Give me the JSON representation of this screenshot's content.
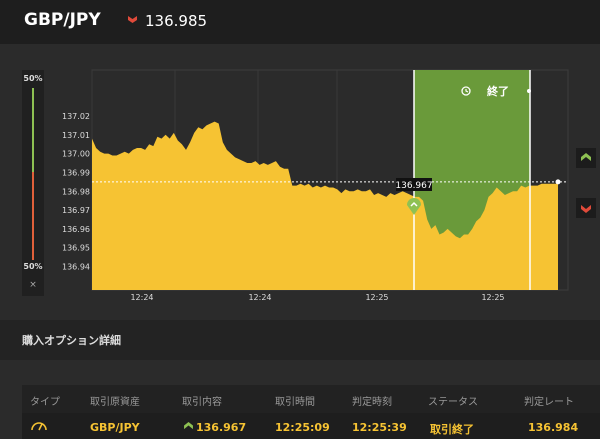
{
  "header": {
    "pair": "GBP/JPY",
    "direction_icon": "chevron-down-icon",
    "price": "136.985"
  },
  "gauge": {
    "top_percent": "50%",
    "bottom_percent": "50%",
    "close_label": "×"
  },
  "chart_data": {
    "type": "area",
    "title": "",
    "ylim": [
      136.93,
      137.03
    ],
    "y_ticks": [
      "137.02",
      "137.01",
      "137.00",
      "136.99",
      "136.98",
      "136.97",
      "136.96",
      "136.95",
      "136.94"
    ],
    "x_ticks": [
      "12:24",
      "12:24",
      "12:25",
      "12:25"
    ],
    "series": [
      {
        "values": [
          137.008,
          137.003,
          137.001,
          137.0,
          137.0,
          136.999,
          136.999,
          137.0,
          137.001,
          137.0,
          137.002,
          137.003,
          137.003,
          137.002,
          137.005,
          137.004,
          137.009,
          137.008,
          137.01,
          137.008,
          137.011,
          137.007,
          137.005,
          137.002,
          137.006,
          137.011,
          137.014,
          137.013,
          137.015,
          137.016,
          137.017,
          137.016,
          137.006,
          137.002,
          137.0,
          136.998,
          136.997,
          136.996,
          136.995,
          136.995,
          136.996,
          136.994,
          136.995,
          136.994,
          136.995,
          136.996,
          136.993,
          136.992,
          136.992,
          136.983,
          136.983,
          136.984,
          136.983,
          136.984,
          136.982,
          136.983,
          136.982,
          136.983,
          136.982,
          136.982,
          136.981,
          136.979,
          136.981,
          136.98,
          136.98,
          136.981,
          136.98,
          136.98,
          136.981,
          136.978,
          136.979,
          136.978,
          136.977,
          136.979,
          136.978,
          136.979,
          136.98,
          136.979,
          136.978,
          136.977,
          136.977,
          136.975,
          136.965,
          136.96,
          136.962,
          136.957,
          136.958,
          136.96,
          136.958,
          136.956,
          136.955,
          136.957,
          136.957,
          136.96,
          136.964,
          136.966,
          136.97,
          136.977,
          136.979,
          136.982,
          136.98,
          136.978,
          136.979,
          136.98,
          136.98,
          136.983,
          136.982,
          136.983,
          136.983,
          136.983,
          136.984,
          136.984,
          136.984,
          136.984,
          136.984
        ]
      }
    ],
    "reference_line": 136.985,
    "entry_marker": {
      "label": "136.967",
      "icon": "chevron-up-icon"
    },
    "expiry_zone": {
      "label": "終了",
      "icon": "clock-icon",
      "color": "#6a9a3a"
    },
    "colors": {
      "fill": "#f6c333",
      "background": "#2b2b2b",
      "grid": "#3a3a3a"
    }
  },
  "buttons": {
    "call_icon": "chevron-up-icon",
    "put_icon": "chevron-down-icon"
  },
  "details": {
    "title": "購入オプション詳細",
    "columns": [
      "タイプ",
      "取引原資産",
      "取引内容",
      "取引時間",
      "判定時刻",
      "ステータス",
      "判定レート"
    ],
    "row": {
      "type_icon": "gauge-icon",
      "asset": "GBP/JPY",
      "direction_icon": "chevron-up-icon",
      "content": "136.967",
      "trade_time": "12:25:09",
      "expiry_time": "12:25:39",
      "status": "取引終了",
      "result_rate": "136.984"
    }
  }
}
